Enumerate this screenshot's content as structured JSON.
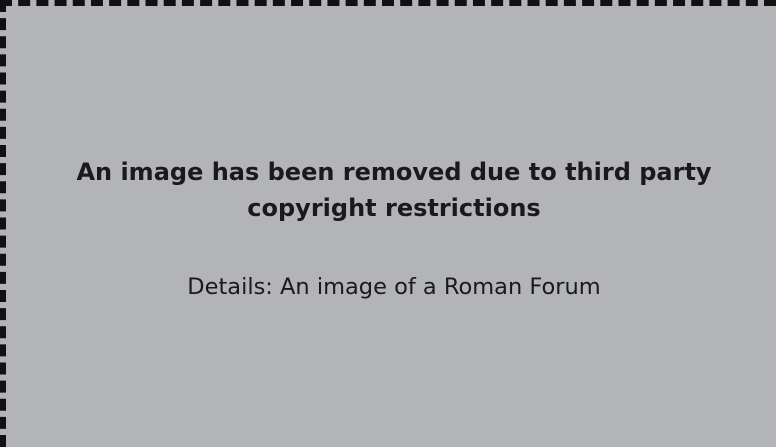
{
  "notice": {
    "title_line1": "An image has been removed due to third party",
    "title_line2": "copyright restrictions",
    "details": "Details: An image of a Roman Forum"
  },
  "colors": {
    "background": "#b3b4b7",
    "border": "#111111",
    "text": "#1a1a1a"
  }
}
